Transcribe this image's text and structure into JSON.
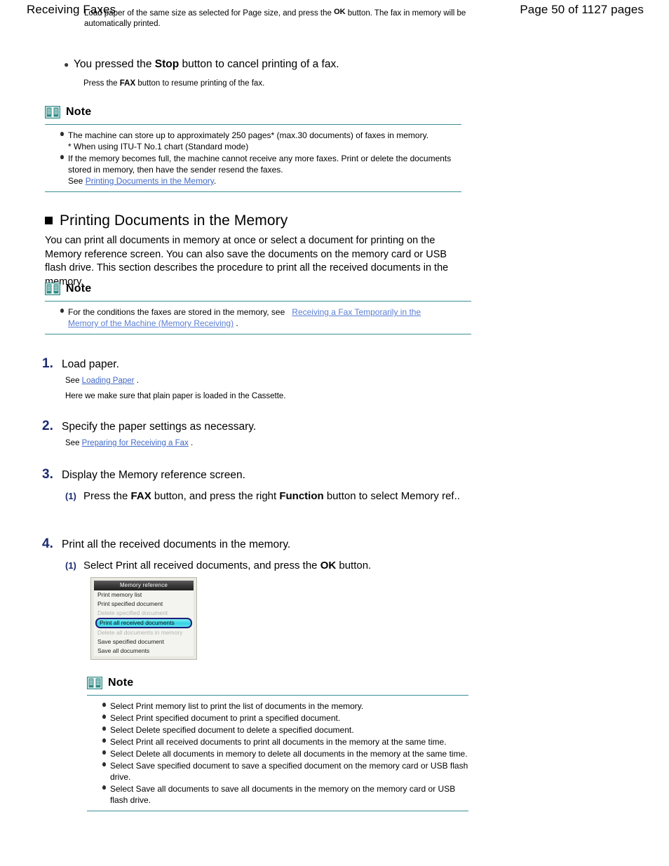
{
  "header": {
    "title": "Receiving Faxes",
    "page_label": "Page 50 of 1127 pages"
  },
  "top_paragraph": {
    "part1": "Load paper of the same size as selected for Page size, and press the ",
    "ok": "OK",
    "part2": " button. The fax in memory will be automatically printed."
  },
  "stop_block": {
    "bullet_part1": "You pressed the ",
    "bold1": "Stop",
    "bullet_part2": " button to cancel printing of a fax.",
    "sub_part1": "Press the ",
    "sub_bold": "FAX",
    "sub_part2": " button to resume printing of the fax."
  },
  "note1": {
    "title": "Note",
    "icon": "book-icon",
    "items": [
      {
        "line1": "The machine can store up to approximately 250 pages* (max.30 documents) of faxes in memory.",
        "line2": "* When using ITU-T No.1 chart (Standard mode)"
      },
      {
        "line1": "If the memory becomes full, the machine cannot receive any more faxes. Print or delete the documents stored in memory, then have the sender resend the faxes.",
        "see_prefix": "See ",
        "link": "Printing Documents in the Memory",
        "see_suffix": "."
      }
    ]
  },
  "section": {
    "bullet": "square-bullet",
    "heading": "Printing Documents in the Memory",
    "paragraph": "You can print all documents in memory at once or select a document for printing on the Memory reference screen. You can also save the documents on the memory card or USB flash drive. This section describes the procedure to print all the received documents in the memory."
  },
  "note2": {
    "title": "Note",
    "icon": "book-icon",
    "item": {
      "text": "For the conditions the faxes are stored in the memory, see",
      "link_line1": "Receiving a Fax Temporarily in the",
      "link_line2": "Memory of the Machine (Memory Receiving)",
      "suffix": "."
    }
  },
  "steps": [
    {
      "num": "1.",
      "title": "Load paper.",
      "see_prefix": "See ",
      "link": "Loading Paper",
      "see_suffix": ".",
      "extra": "Here we make sure that plain paper is loaded in the Cassette."
    },
    {
      "num": "2.",
      "title": "Specify the paper settings as necessary.",
      "see_prefix": "See ",
      "link": "Preparing for Receiving a Fax",
      "see_suffix": "."
    },
    {
      "num": "3.",
      "title": "Display the Memory reference screen.",
      "substep_num": "(1)",
      "sub_part1": "Press the ",
      "sub_bold1": "FAX",
      "sub_part2": " button, and press the right ",
      "sub_bold2": "Function",
      "sub_part3": " button to select Memory ref.."
    },
    {
      "num": "4.",
      "title": "Print all the received documents in the memory.",
      "substep_num": "(1)",
      "sub_part1": "Select Print all received documents, and press the ",
      "sub_bold1": "OK",
      "sub_part2": " button."
    }
  ],
  "lcd": {
    "title": "Memory reference",
    "rows_above": [
      "Print memory list",
      "Print specified document",
      "Delete specified document"
    ],
    "selected_row": "Print all received documents",
    "rows_below": [
      "Delete all documents in memory",
      "Save specified document",
      "Save all documents"
    ]
  },
  "note3": {
    "title": "Note",
    "icon": "book-icon",
    "items": [
      "Select Print memory list to print the list of documents in the memory.",
      "Select Print specified document to print a specified document.",
      "Select Delete specified document to delete a specified document.",
      "Select Print all received documents to print all documents in the memory at the same time.",
      "Select Delete all documents in memory to delete all documents in the memory at the same time.",
      "Select Save specified document to save a specified document on the memory card or USB flash drive.",
      "Select Save all documents to save all documents in the memory on the memory card or USB flash drive."
    ]
  },
  "colors": {
    "link": "#4169c8",
    "link_light": "#5b7fd4",
    "step_number": "#1b2a70",
    "note_rule": "#3b8e96",
    "note_icon": "#2b8a84",
    "lcd_highlight": "#35d2e6",
    "lcd_selection_border": "#1b1f7a"
  }
}
